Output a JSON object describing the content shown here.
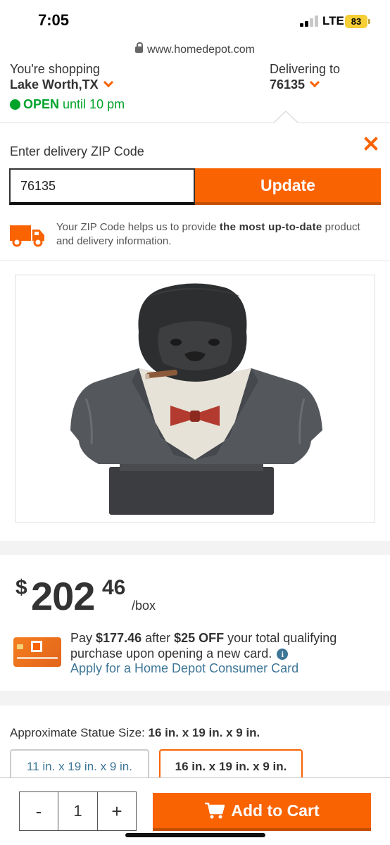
{
  "status_bar": {
    "time": "7:05",
    "network": "LTE",
    "battery": "83"
  },
  "browser": {
    "url": "www.homedepot.com"
  },
  "store": {
    "shopping_label": "You're shopping",
    "city": "Lake Worth,TX",
    "open_status": "OPEN",
    "open_hours": "until 10 pm",
    "delivering_label": "Delivering to",
    "delivery_zip": "76135"
  },
  "zip_panel": {
    "title": "Enter delivery ZIP Code",
    "zip_value": "76135",
    "update_label": "Update",
    "note_prefix": "Your ZIP Code helps us to provide ",
    "note_bold": "the most up-to-date",
    "note_suffix": " product and delivery information."
  },
  "product": {
    "image_alt": "Gorilla statue in suit with red bow tie"
  },
  "price": {
    "currency": "$",
    "dollars": "202",
    "cents": "46",
    "unit": "/box",
    "promo_pay": "Pay ",
    "promo_price": "$177.46",
    "promo_after": " after ",
    "promo_off": "$25 OFF",
    "promo_rest": " your total qualifying purchase upon opening a new card.",
    "apply_link": "Apply for a Home Depot Consumer Card"
  },
  "size": {
    "label": "Approximate Statue Size: ",
    "selected": "16 in. x 19 in. x 9 in.",
    "options": [
      "11 in. x 19 in. x 9 in.",
      "16 in. x 19 in. x 9 in."
    ]
  },
  "cart": {
    "minus": "-",
    "quantity": "1",
    "plus": "+",
    "add_label": "Add to Cart"
  },
  "colors": {
    "brand_orange": "#f96302",
    "open_green": "#00a32a",
    "link_blue": "#3e7697"
  }
}
